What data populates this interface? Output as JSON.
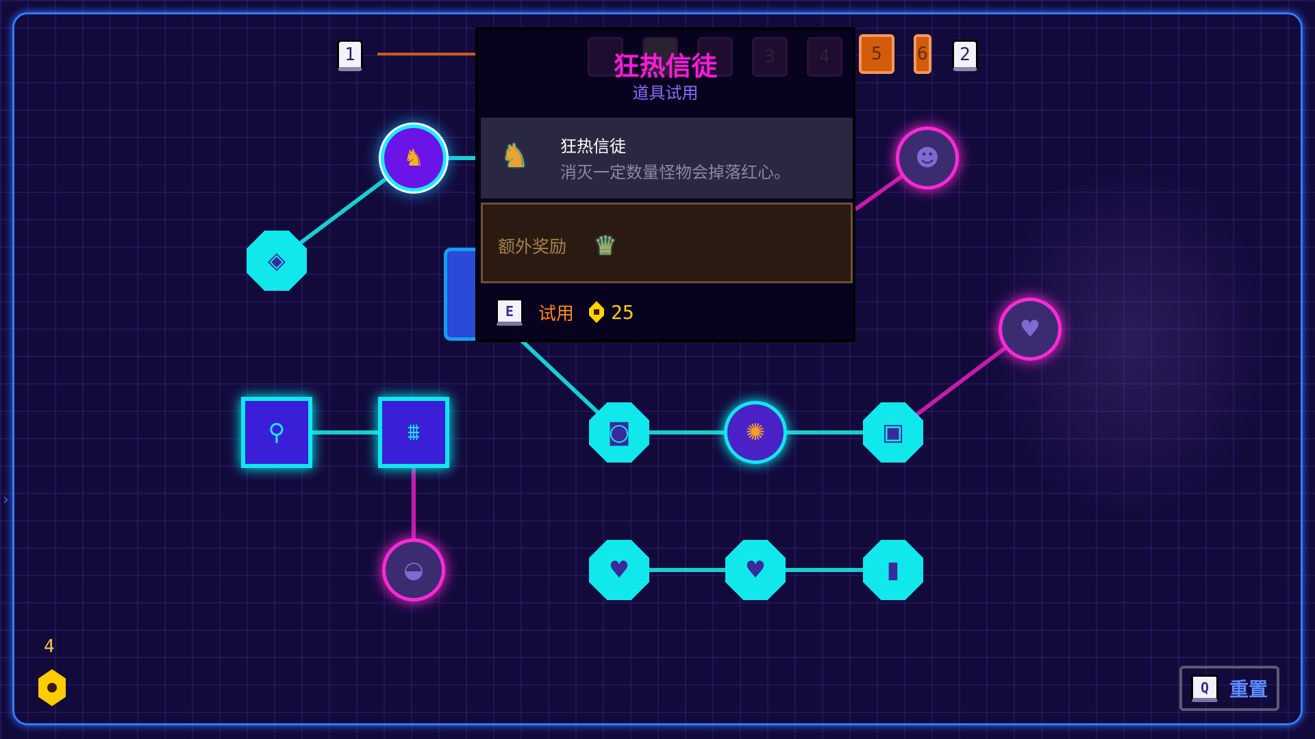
{
  "tier_bar": {
    "start": "1",
    "end": "2",
    "tiers": [
      "3",
      "4",
      "5",
      "6"
    ],
    "highlighted": [
      "5",
      "6"
    ]
  },
  "tooltip": {
    "title": "狂热信徒",
    "subtitle": "道具试用",
    "item_name": "狂热信徒",
    "item_desc": "消灭一定数量怪物会掉落红心。",
    "bonus_label": "额外奖励",
    "bonus_icon": "crown-icon",
    "action_key": "E",
    "action_label": "试用",
    "cost": "25"
  },
  "currency": {
    "count": "4",
    "icon": "gem-coin-icon"
  },
  "reset": {
    "key": "Q",
    "label": "重置"
  },
  "colors": {
    "accent_cyan": "#12e6ef",
    "accent_magenta": "#ff2ad4",
    "title": "#ff1adb",
    "frame": "#2f7dff",
    "orange": "#d35b0c"
  },
  "nodes": [
    {
      "id": "fanatic",
      "icon": "fanatic-helmet-icon",
      "state": "selected"
    },
    {
      "id": "eye-gem",
      "icon": "eye-gem-icon",
      "state": "unlocked"
    },
    {
      "id": "claw",
      "icon": "claw-machine-icon",
      "state": "unlocked"
    },
    {
      "id": "gate",
      "icon": "gate-icon",
      "state": "unlocked"
    },
    {
      "id": "basket",
      "icon": "basket-icon",
      "state": "locked"
    },
    {
      "id": "camera",
      "icon": "camera-icon",
      "state": "unlocked"
    },
    {
      "id": "flower",
      "icon": "flower-icon",
      "state": "unlocked"
    },
    {
      "id": "box",
      "icon": "box-icon",
      "state": "unlocked"
    },
    {
      "id": "broken-heart",
      "icon": "broken-heart-icon",
      "state": "unlocked"
    },
    {
      "id": "heart",
      "icon": "heart-icon",
      "state": "unlocked"
    },
    {
      "id": "portal",
      "icon": "portal-icon",
      "state": "unlocked"
    },
    {
      "id": "frog",
      "icon": "frog-icon",
      "state": "locked"
    },
    {
      "id": "heart-drop",
      "icon": "heart-drop-icon",
      "state": "locked"
    }
  ]
}
